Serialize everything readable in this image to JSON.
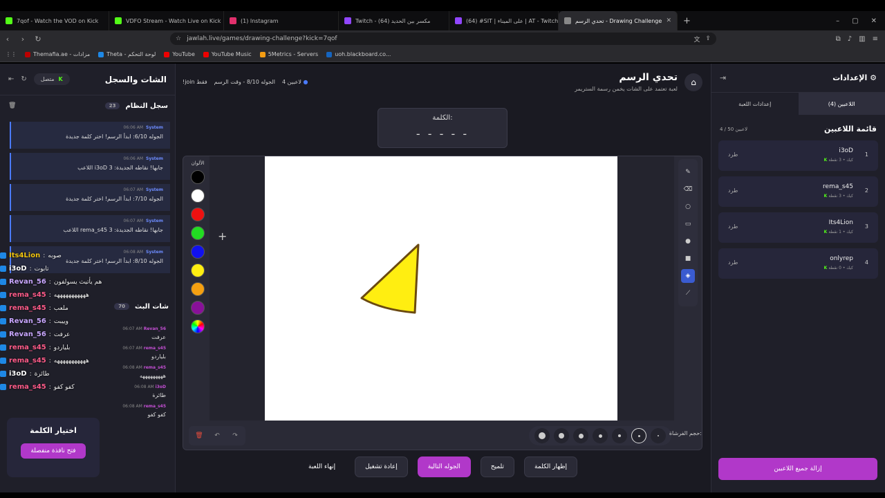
{
  "browser": {
    "tabs": [
      {
        "title": "7qof - Watch the VOD on Kick",
        "color": "#53fc18"
      },
      {
        "title": "VDFO Stream - Watch Live on Kick",
        "color": "#53fc18"
      },
      {
        "title": "(1) Instagram",
        "color": "#e1306c"
      },
      {
        "title": "Twitch - مكسر بين الحديد (64)",
        "color": "#9146ff"
      },
      {
        "title": "(64) #SIT | على الميناء | AT - Twitch",
        "color": "#9146ff"
      },
      {
        "title": "تحدي الرسم - Drawing Challenge",
        "color": "#888888"
      }
    ],
    "url": "jawlah.live/games/drawing-challenge?kick=7qof",
    "bookmarks": [
      "Themafia.ae - مزادات",
      "Theta - لوحة التحكم",
      "YouTube",
      "YouTube Music",
      "5Metrics - Servers",
      "uoh.blackboard.co..."
    ]
  },
  "left": {
    "title": "الشات والسجل",
    "status": "متصل",
    "system_log": {
      "title": "سجل النظام",
      "count": "23"
    },
    "system_msgs": [
      {
        "time": "06:06 AM",
        "sender": "System",
        "text": "الجوله 6/10: ابدأ الرسم! اختر كلمة جديدة"
      },
      {
        "time": "06:06 AM",
        "sender": "System",
        "text": "اللاعب i3oD جابها! نقاطه الجديدة: 3"
      },
      {
        "time": "06:07 AM",
        "sender": "System",
        "text": "الجوله 7/10: ابدأ الرسم! اختر كلمة جديدة"
      },
      {
        "time": "06:07 AM",
        "sender": "System",
        "text": "اللاعب rema_s45 جابها! نقاطه الجديدة: 3"
      },
      {
        "time": "06:08 AM",
        "sender": "System",
        "text": "الجوله 8/10: ابدأ الرسم! اختر كلمة جديدة"
      }
    ],
    "chat": {
      "title": "شات البث",
      "count": "70"
    },
    "chat_msgs": [
      {
        "time": "06:07 AM",
        "user": "Revan_56",
        "text": "عرفت"
      },
      {
        "time": "06:07 AM",
        "user": "rema_s45",
        "text": "بلياردو"
      },
      {
        "time": "06:08 AM",
        "user": "rema_s45",
        "text": "هههههههههه"
      },
      {
        "time": "06:08 AM",
        "user": "i3oD",
        "text": "طائرة"
      },
      {
        "time": "06:08 AM",
        "user": "rema_s45",
        "text": "كفو كفو"
      }
    ],
    "overlay": [
      {
        "user": "Its4Lion",
        "text": "صوبه",
        "color": "#f1c40f"
      },
      {
        "user": "i3oD",
        "text": "تابوت",
        "color": "#ffffff"
      },
      {
        "user": "Revan_56",
        "text": "هم يأتيث يسولفون",
        "color": "#c9a7ff"
      },
      {
        "user": "rema_s45",
        "text": "هههههههههههه",
        "color": "#ff5c8a"
      },
      {
        "user": "rema_s45",
        "text": "ملعب",
        "color": "#ff5c8a"
      },
      {
        "user": "Revan_56",
        "text": "وييبت",
        "color": "#c9a7ff"
      },
      {
        "user": "Revan_56",
        "text": "عرفت",
        "color": "#c9a7ff"
      },
      {
        "user": "rema_s45",
        "text": "بلياردو",
        "color": "#ff5c8a"
      },
      {
        "user": "rema_s45",
        "text": "هههههههههههه",
        "color": "#ff5c8a"
      },
      {
        "user": "i3oD",
        "text": "طائرة",
        "color": "#ffffff"
      },
      {
        "user": "rema_s45",
        "text": "كفو كفو",
        "color": "#ff5c8a"
      }
    ],
    "pick": {
      "title": "اختيار الكلمة",
      "button": "فتح نافذة منفصلة"
    }
  },
  "center": {
    "title": "تحدي الرسم",
    "subtitle": "لعبة تعتمد على الشات يخمن رسمة الستريمر",
    "players_info": "4 لاعبين",
    "round_info": "الجوله 8/10 - وقت الرسم",
    "join_info": "!join فقط",
    "word_label": "الكلمة:",
    "word_mask": "- - - - -",
    "colors_label": "الألوان",
    "colors": [
      "#000000",
      "#ffffff",
      "#ee1111",
      "#22dd22",
      "#1111ee",
      "#ffee11",
      "#f5a011",
      "#881199"
    ],
    "brush_label": "حجم الفرشاة:",
    "brush_selected": 2,
    "actions": [
      "إظهار الكلمة",
      "تلميح",
      "الجوله التالية",
      "إعادة تشغيل",
      "إنهاء اللعبة"
    ]
  },
  "right": {
    "title": "الإعدادات",
    "tabs": [
      "اللاعبين (4)",
      "إعدادات اللعبة"
    ],
    "list_title": "قائمة اللاعبين",
    "list_count": "4 / 50 لاعبين",
    "players": [
      {
        "rank": "1",
        "name": "i3oD",
        "sub": "كيك • 3 نقطة",
        "kick": "طرد"
      },
      {
        "rank": "2",
        "name": "rema_s45",
        "sub": "كيك • 3 نقطة",
        "kick": "طرد"
      },
      {
        "rank": "3",
        "name": "Its4Lion",
        "sub": "كيك • 1 نقطة",
        "kick": "طرد"
      },
      {
        "rank": "4",
        "name": "onlyrep",
        "sub": "كيك • 0 نقطة",
        "kick": "طرد"
      }
    ],
    "clear_button": "إزالة جميع اللاعبين"
  }
}
